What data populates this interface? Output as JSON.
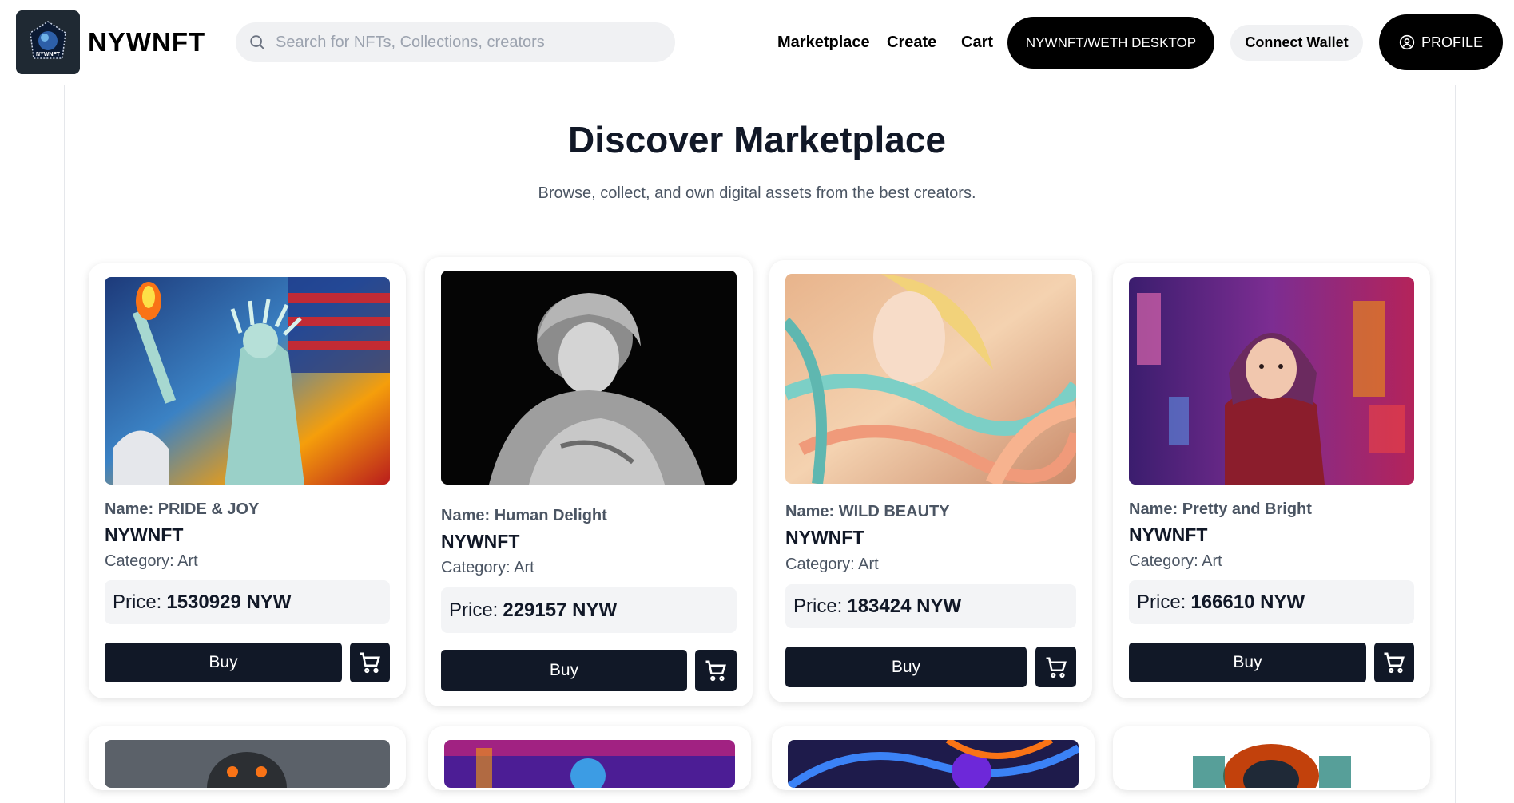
{
  "header": {
    "brand": "NYWNFT",
    "logo_text": "NYWNFT",
    "search_placeholder": "Search for NFTs, Collections, creators",
    "nav": [
      "Marketplace",
      "Create",
      "Cart"
    ],
    "desktop_button": "NYWNFT/WETH DESKTOP",
    "wallet_button": "Connect Wallet",
    "profile_button": "PROFILE"
  },
  "main": {
    "title": "Discover Marketplace",
    "subtitle": "Browse, collect, and own digital assets from the best creators."
  },
  "cards": [
    {
      "name": "Name: PRIDE & JOY",
      "creator": "NYWNFT",
      "category": "Category: Art",
      "price_label": "Price:",
      "price": "1530929 NYW",
      "buy": "Buy"
    },
    {
      "name": "Name: Human Delight",
      "creator": "NYWNFT",
      "category": "Category: Art",
      "price_label": "Price:",
      "price": "229157 NYW",
      "buy": "Buy"
    },
    {
      "name": "Name: WILD BEAUTY",
      "creator": "NYWNFT",
      "category": "Category: Art",
      "price_label": "Price:",
      "price": "183424 NYW",
      "buy": "Buy"
    },
    {
      "name": "Name: Pretty and Bright",
      "creator": "NYWNFT",
      "category": "Category: Art",
      "price_label": "Price:",
      "price": "166610 NYW",
      "buy": "Buy"
    }
  ],
  "colors": {
    "primary_dark": "#111827",
    "button_black": "#000000",
    "muted_bg": "#f3f4f6",
    "muted_text": "#4b5563"
  },
  "icons": {
    "search": "search-icon",
    "profile": "user-circle-icon",
    "cart": "shopping-cart-icon"
  }
}
